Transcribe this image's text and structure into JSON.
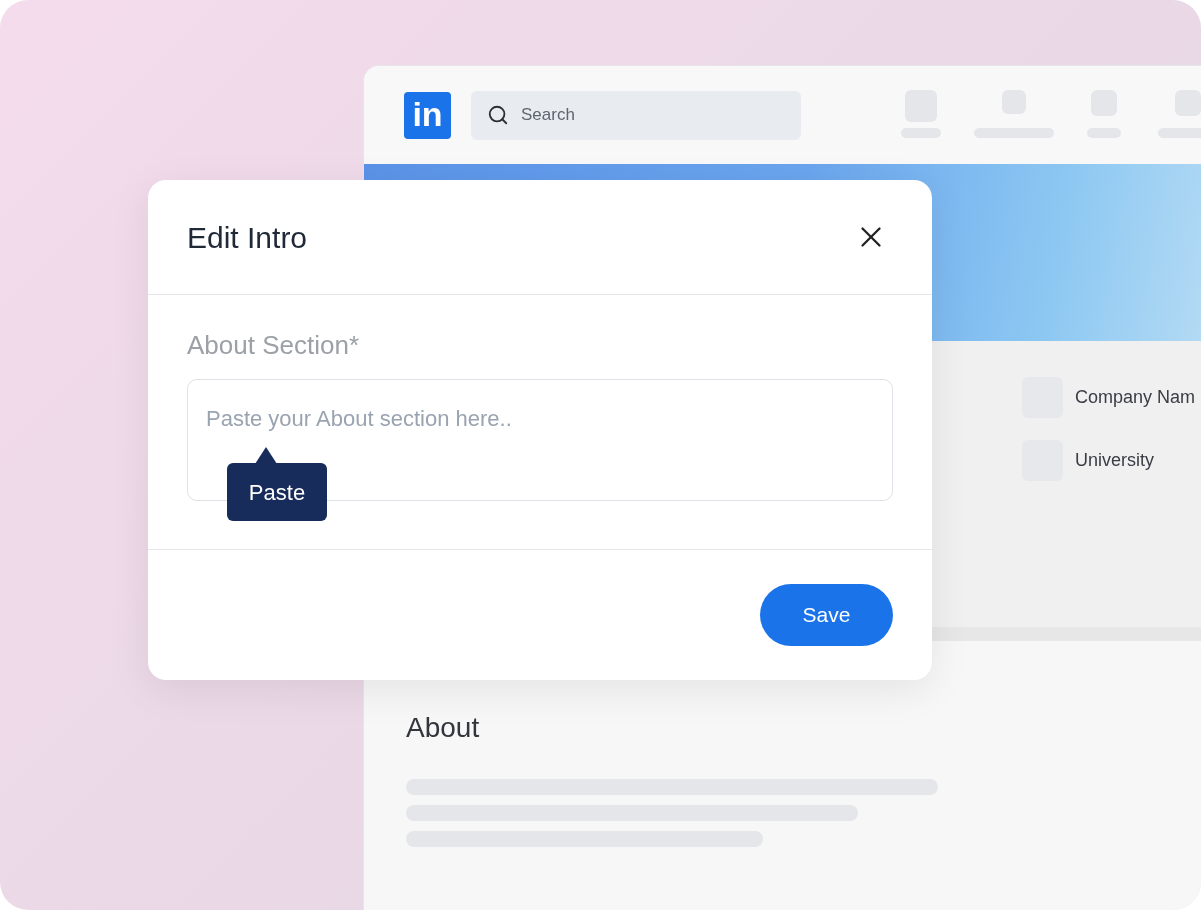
{
  "background_window": {
    "logo": "in",
    "search": {
      "placeholder": "Search"
    },
    "profile_items": [
      {
        "label": "Company Nam"
      },
      {
        "label": "University"
      }
    ],
    "about": {
      "title": "About"
    }
  },
  "dialog": {
    "title": "Edit Intro",
    "field_label": "About Section*",
    "textarea": {
      "placeholder": "Paste your About section here.."
    },
    "tooltip": "Paste",
    "save_button": "Save"
  }
}
